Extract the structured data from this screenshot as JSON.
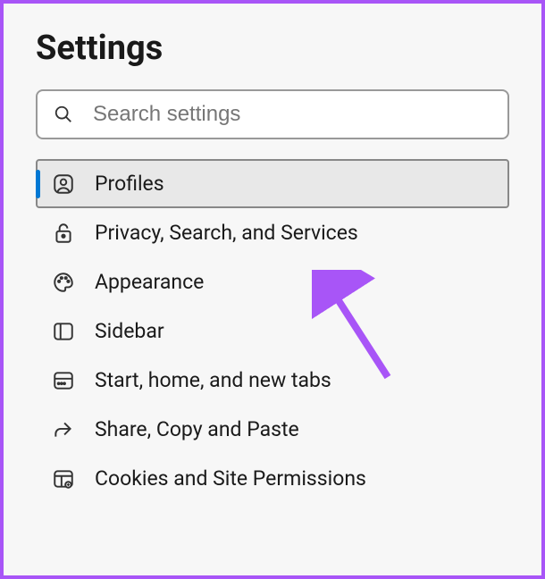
{
  "title": "Settings",
  "search": {
    "placeholder": "Search settings"
  },
  "nav": {
    "items": [
      {
        "id": "profiles",
        "label": "Profiles",
        "icon": "profile-icon",
        "selected": true
      },
      {
        "id": "privacy",
        "label": "Privacy, Search, and Services",
        "icon": "lock-icon",
        "selected": false
      },
      {
        "id": "appearance",
        "label": "Appearance",
        "icon": "palette-icon",
        "selected": false
      },
      {
        "id": "sidebar",
        "label": "Sidebar",
        "icon": "sidebar-icon",
        "selected": false
      },
      {
        "id": "start",
        "label": "Start, home, and new tabs",
        "icon": "tabs-icon",
        "selected": false
      },
      {
        "id": "share",
        "label": "Share, Copy and Paste",
        "icon": "share-icon",
        "selected": false
      },
      {
        "id": "cookies",
        "label": "Cookies and Site Permissions",
        "icon": "cookies-icon",
        "selected": false
      }
    ]
  },
  "accent_color": "#a855f7"
}
